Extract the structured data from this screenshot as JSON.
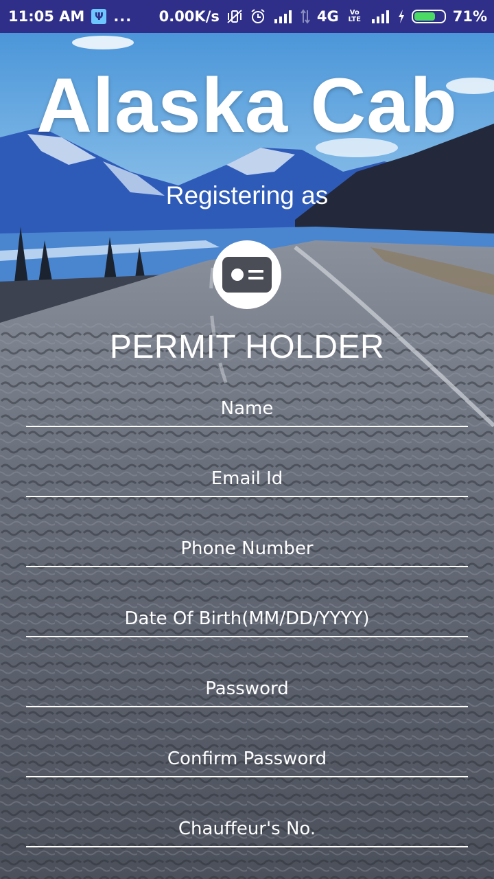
{
  "status_bar": {
    "time": "11:05 AM",
    "usb_icon": "usb-icon",
    "more_icon": "...",
    "net_speed": "0.00K/s",
    "network_type": "4G",
    "volte_label": "Vo LTE",
    "battery_percent": "71%",
    "battery_level": 0.71,
    "battery_color": "#4cd964",
    "bar_color": "#2f2f8a"
  },
  "header": {
    "app_title": "Alaska Cab",
    "registering_label": "Registering as",
    "role_icon": "id-card-icon",
    "role_label": "PERMIT HOLDER"
  },
  "form": {
    "fields": [
      {
        "name": "name-field",
        "placeholder": "Name",
        "value": ""
      },
      {
        "name": "email-field",
        "placeholder": "Email Id",
        "value": ""
      },
      {
        "name": "phone-field",
        "placeholder": "Phone Number",
        "value": ""
      },
      {
        "name": "dob-field",
        "placeholder": "Date Of Birth(MM/DD/YYYY)",
        "value": ""
      },
      {
        "name": "password-field",
        "placeholder": "Password",
        "value": ""
      },
      {
        "name": "confirm-password-field",
        "placeholder": "Confirm Password",
        "value": ""
      },
      {
        "name": "chauffeur-number-field",
        "placeholder": "Chauffeur's No.",
        "value": ""
      }
    ]
  }
}
